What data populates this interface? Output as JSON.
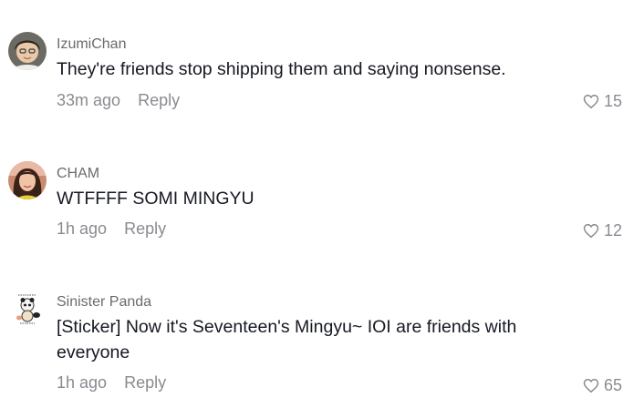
{
  "comments": [
    {
      "username": "IzumiChan",
      "text": "They're friends stop shipping them and saying nonsense.",
      "time": "33m ago",
      "reply_label": "Reply",
      "likes": "15",
      "avatar_icon": "user-photo-avatar"
    },
    {
      "username": "CHAM",
      "text": "WTFFFF SOMI MINGYU",
      "time": "1h ago",
      "reply_label": "Reply",
      "likes": "12",
      "avatar_icon": "user-photo-avatar"
    },
    {
      "username": "Sinister Panda",
      "text": "[Sticker] Now it's Seventeen's Mingyu~ IOI are friends with everyone",
      "time": "1h ago",
      "reply_label": "Reply",
      "likes": "65",
      "avatar_icon": "panda-cartoon-avatar"
    }
  ],
  "colors": {
    "text": "#161823",
    "secondary": "#8a8b91",
    "username": "#6b6b6b"
  },
  "icons": {
    "like": "heart-outline-icon"
  }
}
